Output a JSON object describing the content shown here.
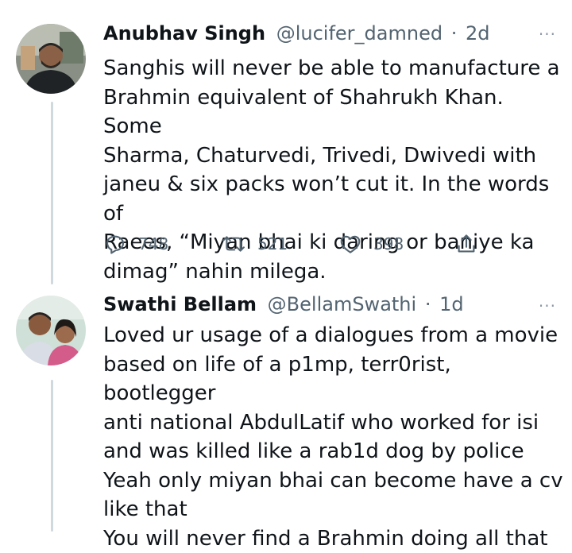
{
  "tweets": [
    {
      "display_name": "Anubhav Singh",
      "handle": "@lucifer_damned",
      "separator": "·",
      "time": "2d",
      "more_label": "···",
      "text": "Sanghis will never be able to manufacture a\nBrahmin equivalent of Shahrukh Khan. Some\nSharma, Chaturvedi, Trivedi, Dwivedi with\njaneu & six packs won’t cut it. In the words of\nRaees, “Miyan bhai ki daring or baniye ka\ndimag” nahin milega.",
      "replies": "748",
      "retweets": "521",
      "likes": "398",
      "icons": {
        "reply": "reply-icon",
        "retweet": "retweet-icon",
        "like": "heart-icon",
        "share": "share-icon"
      }
    },
    {
      "display_name": "Swathi Bellam",
      "handle": "@BellamSwathi",
      "separator": "·",
      "time": "1d",
      "more_label": "···",
      "text": "Loved ur usage of a dialogues from a movie\nbased on life of a p1mp, terr0rist, bootlegger\nanti national AbdulLatif who worked for isi\nand was killed like a rab1d dog by police\nYeah only miyan bhai can become have a cv\nlike that\nYou will never find a Brahmin doing all that"
    }
  ],
  "colors": {
    "text": "#0f1419",
    "secondary": "#536471",
    "thread_line": "#cfd9de"
  }
}
